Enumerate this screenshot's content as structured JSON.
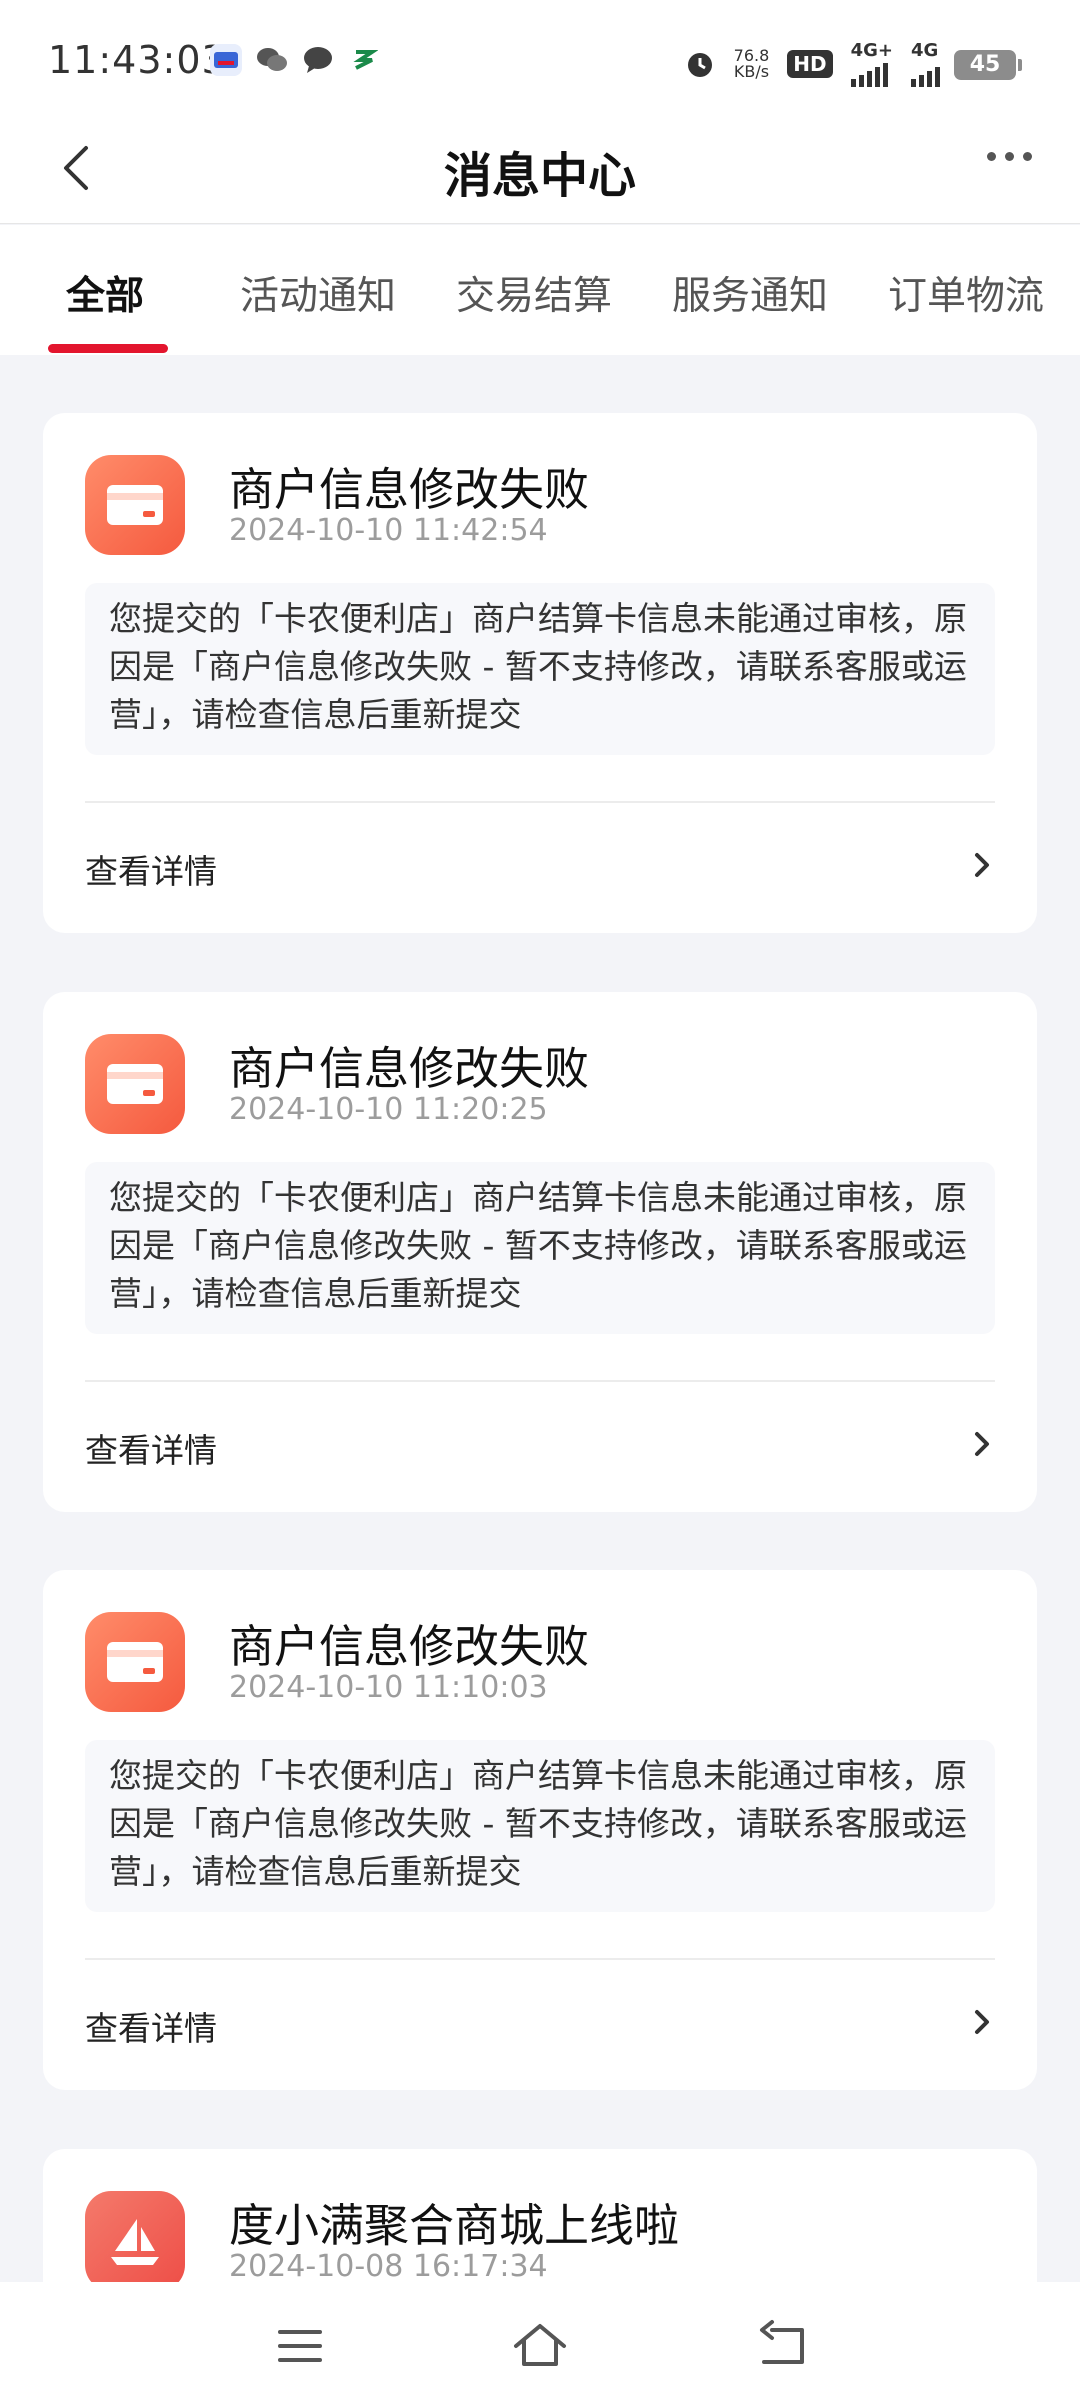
{
  "status_bar": {
    "time": "11:43:03",
    "net_speed_value": "76.8",
    "net_speed_unit": "KB/s",
    "hd_label": "HD",
    "sim1_label": "4G+",
    "sim2_label": "4G",
    "battery": "45"
  },
  "header": {
    "title": "消息中心"
  },
  "tabs": [
    {
      "label": "全部",
      "active": true
    },
    {
      "label": "活动通知",
      "active": false
    },
    {
      "label": "交易结算",
      "active": false
    },
    {
      "label": "服务通知",
      "active": false
    },
    {
      "label": "订单物流",
      "active": false
    }
  ],
  "messages": [
    {
      "icon": "card-icon",
      "title": "商户信息修改失败",
      "time": "2024-10-10 11:42:54",
      "body": "您提交的「卡农便利店」商户结算卡信息未能通过审核，原因是「商户信息修改失败 - 暂不支持修改，请联系客服或运营」，请检查信息后重新提交",
      "link": "查看详情"
    },
    {
      "icon": "card-icon",
      "title": "商户信息修改失败",
      "time": "2024-10-10 11:20:25",
      "body": "您提交的「卡农便利店」商户结算卡信息未能通过审核，原因是「商户信息修改失败 - 暂不支持修改，请联系客服或运营」，请检查信息后重新提交",
      "link": "查看详情"
    },
    {
      "icon": "card-icon",
      "title": "商户信息修改失败",
      "time": "2024-10-10 11:10:03",
      "body": "您提交的「卡农便利店」商户结算卡信息未能通过审核，原因是「商户信息修改失败 - 暂不支持修改，请联系客服或运营」，请检查信息后重新提交",
      "link": "查看详情"
    },
    {
      "icon": "sailboat-icon",
      "title": "度小满聚合商城上线啦",
      "time": "2024-10-08 16:17:34"
    }
  ],
  "colors": {
    "accent": "#e3152e",
    "icon_gradient_start": "#ff8c6a",
    "icon_gradient_end": "#f55a3f",
    "background": "#f3f4f8"
  }
}
